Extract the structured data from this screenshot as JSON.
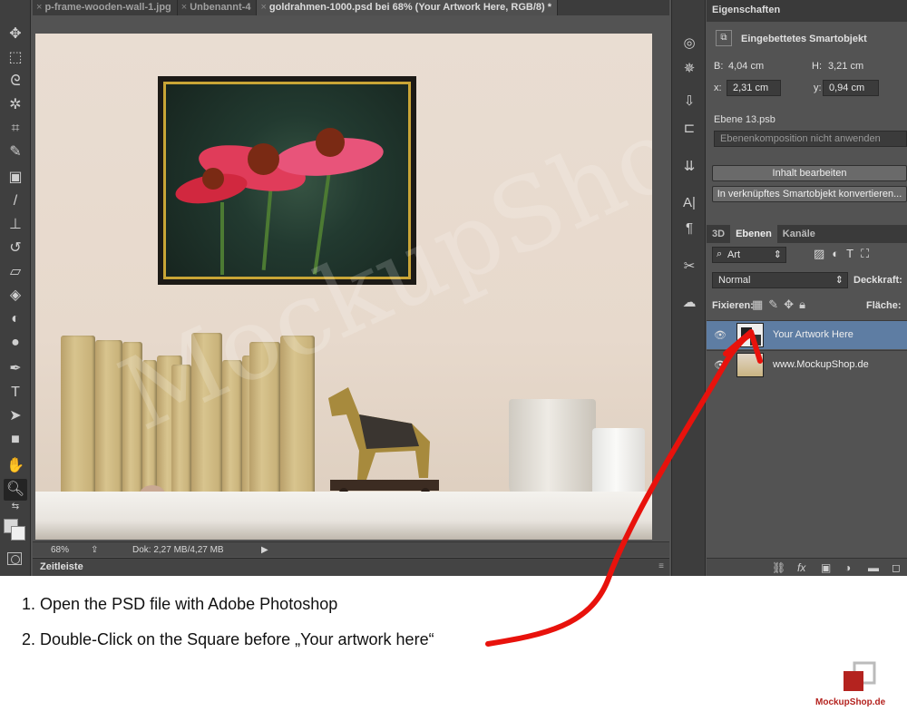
{
  "tabs": [
    {
      "label": "p-frame-wooden-wall-1.jpg",
      "close": "×"
    },
    {
      "label": "Unbenannt-4",
      "close": "×"
    },
    {
      "label": "goldrahmen-1000.psd bei 68% (Your Artwork Here, RGB/8) *",
      "close": "×"
    }
  ],
  "status": {
    "zoom": "68%",
    "doc": "Dok: 2,27 MB/4,27 MB"
  },
  "timeline": {
    "label": "Zeitleiste"
  },
  "properties": {
    "title": "Eigenschaften",
    "type": "Eingebettetes Smartobjekt",
    "w_label": "B:",
    "w_value": "4,04 cm",
    "h_label": "H:",
    "h_value": "3,21 cm",
    "x_label": "x:",
    "x_value": "2,31 cm",
    "y_label": "y:",
    "y_value": "0,94 cm",
    "file": "Ebene 13.psb",
    "comp": "Ebenenkomposition nicht anwenden",
    "edit_btn": "Inhalt bearbeiten",
    "convert_btn": "In verknüpftes Smartobjekt konvertieren..."
  },
  "layers": {
    "tabs": [
      "3D",
      "Ebenen",
      "Kanäle"
    ],
    "filter": "Art",
    "blend": "Normal",
    "opacity_label": "Deckkraft:",
    "lock_label": "Fixieren:",
    "fill_label": "Fläche:",
    "items": [
      {
        "name": "Your Artwork Here",
        "selected": true
      },
      {
        "name": "www.MockupShop.de",
        "selected": false
      }
    ]
  },
  "instructions": [
    "1. Open the PSD file with Adobe Photoshop",
    "2. Double-Click on the Square before „Your artwork here“"
  ],
  "brand": {
    "name": "MockupShop.de",
    "color": "#b4231f"
  },
  "accent": {
    "arrow": "#e8120c",
    "selection": "#5e7da3"
  }
}
